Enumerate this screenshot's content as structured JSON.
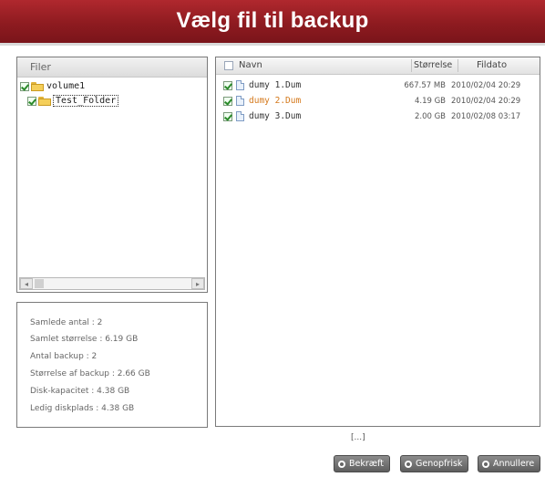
{
  "title": "Vælg fil til backup",
  "tree": {
    "header": "Filer",
    "nodes": [
      {
        "label": "volume1",
        "checked": true
      },
      {
        "label": "Test_Folder",
        "checked": true
      }
    ]
  },
  "stats": [
    "Samlede antal : 2",
    "Samlet størrelse : 6.19 GB",
    "Antal backup : 2",
    "Størrelse af backup : 2.66 GB",
    "Disk-kapacitet : 4.38 GB",
    "Ledig diskplads : 4.38 GB"
  ],
  "files": {
    "columns": {
      "name": "Navn",
      "size": "Størrelse",
      "date": "Fildato"
    },
    "rows": [
      {
        "name": "dumy 1.Dum",
        "size": "667.57 MB",
        "date": "2010/02/04 20:29",
        "checked": true,
        "highlight": false
      },
      {
        "name": "dumy 2.Dum",
        "size": "4.19 GB",
        "date": "2010/02/04 20:29",
        "checked": true,
        "highlight": true
      },
      {
        "name": "dumy 3.Dum",
        "size": "2.00 GB",
        "date": "2010/02/08 03:17",
        "checked": true,
        "highlight": false
      }
    ]
  },
  "pager": "[...]",
  "buttons": {
    "confirm": "Bekræft",
    "refresh": "Genopfrisk",
    "cancel": "Annullere"
  },
  "colors": {
    "titlebar": "#8e1b20",
    "highlight_file": "#d4781a",
    "button": "#6e6e6e"
  }
}
